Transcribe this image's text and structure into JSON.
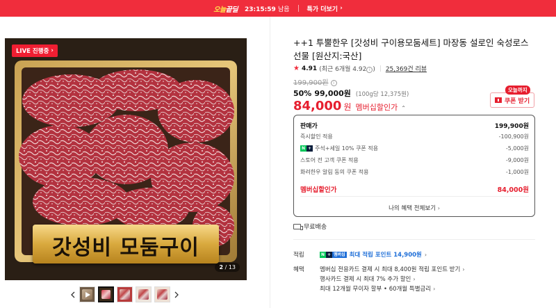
{
  "banner": {
    "logo_prefix": "오늘",
    "logo_suffix": "끝딜",
    "timer": "23:15:59",
    "timer_suffix": "남음",
    "link_label": "특가 더보기"
  },
  "gallery": {
    "live_label": "LIVE 진행중",
    "caption": "갓성비 모둠구이",
    "current_index": "2",
    "total": "13"
  },
  "product": {
    "title": "++1 투뿔한우 [갓성비 구이용모둠세트] 마장동 설로인 숙성로스 선물 [원산지:국산]",
    "rating": "4.91",
    "rating_detail": "(최근 6개월 4.92",
    "rating_detail_end": ")",
    "reviews": "25,369건 리뷰",
    "original_price": "199,900원",
    "discount_pct": "50%",
    "sale_price": "99,000원",
    "unit_price": "(100g당 12,375원)",
    "member_price": "84,000",
    "member_price_won": "원",
    "member_label": "멤버십할인가"
  },
  "coupon": {
    "badge": "오늘까지",
    "label": "쿠폰 받기"
  },
  "breakdown": {
    "rows": [
      {
        "label": "판매가",
        "value": "199,900원"
      },
      {
        "label": "즉시할인 적용",
        "value": "-100,900원"
      },
      {
        "label": "주석+세일 10% 쿠폰 적용",
        "value": "-5,000원"
      },
      {
        "label": "스토어 전 고객 쿠폰 적용",
        "value": "-9,000원"
      },
      {
        "label": "화려한우 알림 동의 쿠폰 적용",
        "value": "-1,000원"
      }
    ],
    "member_label": "멤버십할인가",
    "member_value": "84,000원",
    "all_benefits": "나의 혜택 전체보기"
  },
  "shipping": {
    "label": "무료배송"
  },
  "benefits": {
    "points_label": "적립",
    "points_text": "최대 적립 포인트 14,900원",
    "perks_label": "혜택",
    "lines": [
      "멤버십 전용카드 결제 시 최대 8,400원 적립 포인트 받기",
      "행사카드 결제 시 최대 7% 추가 할인",
      "최대 12개월 무이자 할부 • 60개월 특별금리"
    ]
  },
  "colors": {
    "accent": "#e61e2e",
    "banner": "#f02d3c",
    "points": "#1f6fd8",
    "naver_green": "#03c75a"
  }
}
